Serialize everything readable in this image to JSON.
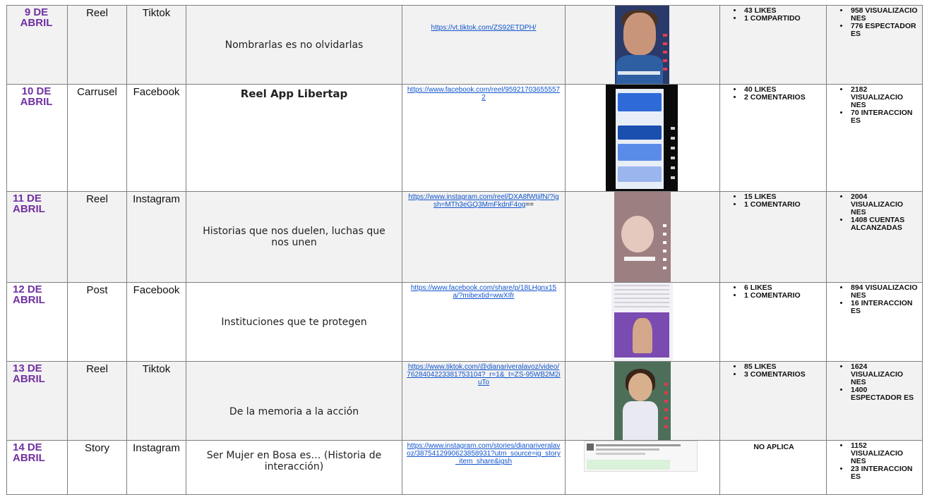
{
  "rows": [
    {
      "date": "9 DE ABRIL",
      "type": "Reel",
      "platform": "Tiktok",
      "title": "Nombrarlas es no olvidarlas",
      "link": "https://vt.tiktok.com/ZS92ETDPH/",
      "link_tail": "",
      "thumbnail_icon": "tiktok-video-thumbnail",
      "engagement": [
        "43 LIKES",
        "1 COMPARTIDO"
      ],
      "reach": [
        "958 VISUALIZACIO NES",
        "776 ESPECTADOR ES"
      ]
    },
    {
      "date": "10 DE ABRIL",
      "type": "Carrusel",
      "platform": "Facebook",
      "title": "Reel App Libertap",
      "link": "https://www.facebook.com/reel/959217036555572",
      "link_tail": "",
      "thumbnail_icon": "facebook-reel-thumbnail",
      "engagement": [
        "40 LIKES",
        "2 COMENTARIOS"
      ],
      "reach": [
        "2182 VISUALIZACIO NES",
        "70 INTERACCION ES"
      ]
    },
    {
      "date": "11 DE ABRIL",
      "type": "Reel",
      "platform": "Instagram",
      "title": "Historias que nos duelen, luchas que nos unen",
      "link": "https://www.instagram.com/reel/DXA8fWtjifN/?igsh=MTh3eGQ3MmFkdnF4og",
      "link_tail": "==",
      "thumbnail_icon": "instagram-reel-thumbnail",
      "engagement": [
        "15 LIKES",
        "1 COMENTARIO"
      ],
      "reach": [
        "2004 VISUALIZACIO NES",
        "1408 CUENTAS ALCANZADAS"
      ]
    },
    {
      "date": "12 DE ABRIL",
      "type": "Post",
      "platform": "Facebook",
      "title": "Instituciones que te protegen",
      "link": "https://www.facebook.com/share/p/18LHgnx15a/?mibextid=wwXIfr",
      "link_tail": "",
      "thumbnail_icon": "facebook-post-thumbnail",
      "engagement": [
        "6 LIKES",
        "1 COMENTARIO"
      ],
      "reach": [
        "894 VISUALIZACIO NES",
        "16 INTERACCION ES"
      ]
    },
    {
      "date": "13 DE ABRIL",
      "type": "Reel",
      "platform": "Tiktok",
      "title": "De la memoria a la acción",
      "link": "https://www.tiktok.com/@dianariveralavoz/video/7628404223381753104?_r=1&_t=ZS-95WB2M2iuTo",
      "link_tail": "",
      "thumbnail_icon": "tiktok-video-thumbnail",
      "engagement": [
        "85 LIKES",
        "3 COMENTARIOS"
      ],
      "reach": [
        "1624 VISUALIZACIO NES",
        "1400 ESPECTADOR ES"
      ]
    },
    {
      "date": "14 DE ABRIL",
      "type": "Story",
      "platform": "Instagram",
      "title": "Ser Mujer en Bosa es… (Historia de interacción)",
      "link": "https://www.instagram.com/stories/dianariveralavoz/3875412990623858931?utm_source=ig_story_item_share&igsh",
      "link_tail": "",
      "thumbnail_icon": "instagram-story-screenshot-thumbnail",
      "engagement_na": "NO APLICA",
      "reach": [
        "1152 VISUALIZACIO NES",
        "23 INTERACCION ES"
      ]
    }
  ]
}
